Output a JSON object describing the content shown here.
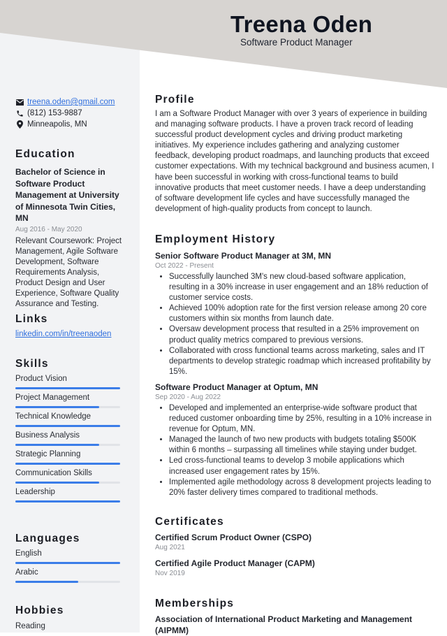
{
  "header": {
    "name": "Treena Oden",
    "title": "Software Product Manager"
  },
  "contact": {
    "email": "treena.oden@gmail.com",
    "phone": "(812) 153-9887",
    "location": "Minneapolis, MN"
  },
  "education": {
    "title": "Education",
    "degree": "Bachelor of Science in Software Product Management at University of Minnesota Twin Cities, MN",
    "dates": "Aug 2016 - May 2020",
    "details": "Relevant Coursework: Project Management, Agile Software Development, Software Requirements Analysis, Product Design and User Experience, Software Quality Assurance and Testing."
  },
  "links": {
    "title": "Links",
    "items": [
      "linkedin.com/in/treenaoden"
    ]
  },
  "skills": {
    "title": "Skills",
    "items": [
      {
        "label": "Product Vision",
        "level": 1.0
      },
      {
        "label": "Project Management",
        "level": 0.8
      },
      {
        "label": "Technical Knowledge",
        "level": 1.0
      },
      {
        "label": "Business Analysis",
        "level": 0.8
      },
      {
        "label": "Strategic Planning",
        "level": 1.0
      },
      {
        "label": "Communication Skills",
        "level": 0.8
      },
      {
        "label": "Leadership",
        "level": 1.0
      }
    ]
  },
  "languages": {
    "title": "Languages",
    "items": [
      {
        "label": "English",
        "level": 1.0
      },
      {
        "label": "Arabic",
        "level": 0.6
      }
    ]
  },
  "hobbies": {
    "title": "Hobbies",
    "items": [
      "Reading"
    ]
  },
  "profile": {
    "title": "Profile",
    "text": "I am a Software Product Manager with over 3 years of experience in building and managing software products. I have a proven track record of leading successful product development cycles and driving product marketing initiatives. My experience includes gathering and analyzing customer feedback, developing product roadmaps, and launching products that exceed customer expectations. With my technical background and business acumen, I have been successful in working with cross-functional teams to build innovative products that meet customer needs. I have a deep understanding of software development life cycles and have successfully managed the development of high-quality products from concept to launch."
  },
  "employment": {
    "title": "Employment History",
    "jobs": [
      {
        "title": "Senior Software Product Manager at 3M, MN",
        "dates": "Oct 2022 - Present",
        "bullets": [
          "Successfully launched 3M's new cloud-based software application, resulting in a 30% increase in user engagement and an 18% reduction of customer service costs.",
          "Achieved 100% adoption rate for the first version release among 20 core customers within six months from launch date.",
          "Oversaw development process that resulted in a 25% improvement on product quality metrics compared to previous versions.",
          "Collaborated with cross functional teams across marketing, sales and IT departments to develop strategic roadmap which increased profitability by 15%."
        ]
      },
      {
        "title": "Software Product Manager at Optum, MN",
        "dates": "Sep 2020 - Aug 2022",
        "bullets": [
          "Developed and implemented an enterprise-wide software product that reduced customer onboarding time by 25%, resulting in a 10% increase in revenue for Optum, MN.",
          "Managed the launch of two new products with budgets totaling $500K within 6 months – surpassing all timelines while staying under budget.",
          "Led cross-functional teams to develop 3 mobile applications which increased user engagement rates by 15%.",
          "Implemented agile methodology across 8 development projects leading to 20% faster delivery times compared to traditional methods."
        ]
      }
    ]
  },
  "certificates": {
    "title": "Certificates",
    "items": [
      {
        "name": "Certified Scrum Product Owner (CSPO)",
        "date": "Aug 2021"
      },
      {
        "name": "Certified Agile Product Manager (CAPM)",
        "date": "Nov 2019"
      }
    ]
  },
  "memberships": {
    "title": "Memberships",
    "items": [
      "Association of International Product Marketing and Management (AIPMM)"
    ]
  },
  "colors": {
    "accent": "#3b7de8",
    "link": "#2f6fde",
    "header_band": "#d7d4d1",
    "sidebar": "#f2f3f5"
  }
}
